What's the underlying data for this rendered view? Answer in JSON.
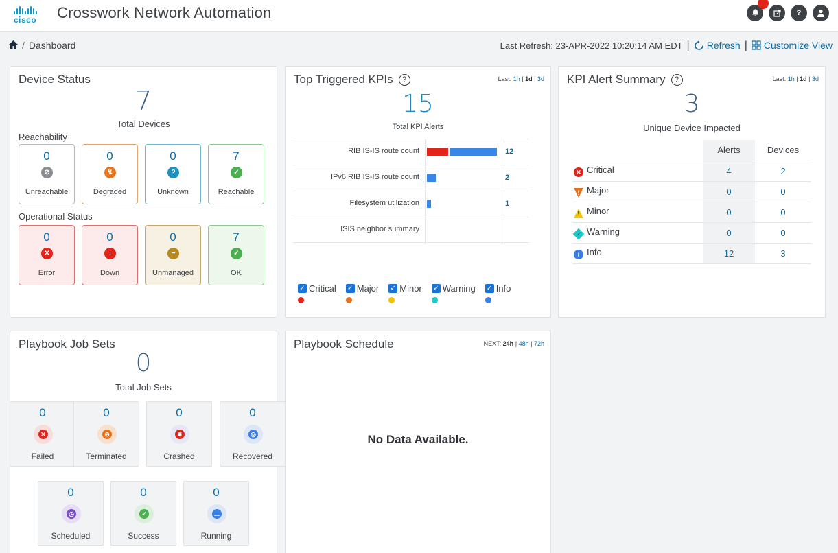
{
  "header": {
    "logo_text": "cisco",
    "title": "Crosswork Network Automation",
    "icons": [
      "bell-icon",
      "external-link-icon",
      "help-icon",
      "user-icon"
    ]
  },
  "breadcrumb": {
    "home_icon": "home-icon",
    "separator": "/",
    "current": "Dashboard"
  },
  "toolbar": {
    "last_refresh": "Last Refresh: 23-APR-2022 10:20:14 AM EDT",
    "refresh_label": "Refresh",
    "customize_label": "Customize View"
  },
  "device_status": {
    "title": "Device Status",
    "total": "7",
    "total_label": "Total Devices",
    "reachability_label": "Reachability",
    "reachability": [
      {
        "count": "0",
        "label": "Unreachable",
        "color": "#8a8d91",
        "border": "#b7babd",
        "glyph": "⊘"
      },
      {
        "count": "0",
        "label": "Degraded",
        "color": "#e8731f",
        "border": "#e8a66a",
        "glyph": "↯"
      },
      {
        "count": "0",
        "label": "Unknown",
        "color": "#1e90c0",
        "border": "#6cb9d6",
        "glyph": "?"
      },
      {
        "count": "7",
        "label": "Reachable",
        "color": "#4caf50",
        "border": "#8ec78f",
        "glyph": "✓"
      }
    ],
    "operational_label": "Operational Status",
    "operational": [
      {
        "count": "0",
        "label": "Error",
        "color": "#e2231a",
        "border": "#e36d6d",
        "bg": "#fdebeb",
        "glyph": "✕"
      },
      {
        "count": "0",
        "label": "Down",
        "color": "#e2231a",
        "border": "#e36d6d",
        "bg": "#fdebeb",
        "glyph": "↓"
      },
      {
        "count": "0",
        "label": "Unmanaged",
        "color": "#b8891c",
        "border": "#c9a96a",
        "bg": "#f7f1e4",
        "glyph": "−"
      },
      {
        "count": "7",
        "label": "OK",
        "color": "#4caf50",
        "border": "#8ec78f",
        "bg": "#eef7ec",
        "glyph": "✓"
      }
    ]
  },
  "top_kpis": {
    "title": "Top Triggered KPIs",
    "range_prefix": "Last:",
    "range_1h": "1h",
    "range_1d": "1d",
    "range_3d": "3d",
    "sep": "|",
    "total": "15",
    "total_label": "Total KPI Alerts",
    "rows": [
      {
        "name": "RIB IS-IS route count",
        "value": "12",
        "critical": 4,
        "info": 12
      },
      {
        "name": "IPv6 RIB IS-IS route count",
        "value": "2",
        "critical": 0,
        "info": 2
      },
      {
        "name": "Filesystem utilization",
        "value": "1",
        "critical": 0,
        "info": 1
      },
      {
        "name": "ISIS neighbor summary",
        "value": "",
        "critical": 0,
        "info": 0
      }
    ],
    "legend": [
      {
        "label": "Critical",
        "color": "#e2231a"
      },
      {
        "label": "Major",
        "color": "#e8731f"
      },
      {
        "label": "Minor",
        "color": "#f2c500"
      },
      {
        "label": "Warning",
        "color": "#1ec9c9"
      },
      {
        "label": "Info",
        "color": "#3a7ee8"
      }
    ]
  },
  "kpi_alert_summary": {
    "title": "KPI Alert Summary",
    "range_prefix": "Last:",
    "range_1h": "1h",
    "range_1d": "1d",
    "range_3d": "3d",
    "sep": "|",
    "total": "3",
    "total_label": "Unique Device Impacted",
    "col_alerts": "Alerts",
    "col_devices": "Devices",
    "rows": [
      {
        "severity": "Critical",
        "alerts": "4",
        "devices": "2",
        "icon": "critical-icon",
        "color": "#e2231a",
        "glyph": "✕"
      },
      {
        "severity": "Major",
        "alerts": "0",
        "devices": "0",
        "icon": "major-icon",
        "color": "#e8731f",
        "glyph": "!"
      },
      {
        "severity": "Minor",
        "alerts": "0",
        "devices": "0",
        "icon": "minor-icon",
        "color": "#f2c500",
        "glyph": "!"
      },
      {
        "severity": "Warning",
        "alerts": "0",
        "devices": "0",
        "icon": "warning-icon",
        "color": "#1ec9c9",
        "glyph": "!"
      },
      {
        "severity": "Info",
        "alerts": "12",
        "devices": "3",
        "icon": "info-icon",
        "color": "#3a7ee8",
        "glyph": "i"
      }
    ]
  },
  "playbook_job_sets": {
    "title": "Playbook Job Sets",
    "total": "0",
    "total_label": "Total Job Sets",
    "row1": [
      {
        "count": "0",
        "label": "Failed",
        "color": "#e2231a",
        "bg": "#f8dcdc",
        "glyph": "✕"
      },
      {
        "count": "0",
        "label": "Terminated",
        "color": "#e8731f",
        "bg": "#f9e0cc",
        "glyph": "⊘"
      },
      {
        "count": "0",
        "label": "Crashed",
        "color": "#e2231a",
        "bg": "#e6e7f5",
        "glyph": "✸"
      },
      {
        "count": "0",
        "label": "Recovered",
        "color": "#3a7ee8",
        "bg": "#dde6f7",
        "glyph": "◎"
      }
    ],
    "row2": [
      {
        "count": "0",
        "label": "Scheduled",
        "color": "#7b4fc9",
        "bg": "#e6dcf5",
        "glyph": "◷"
      },
      {
        "count": "0",
        "label": "Success",
        "color": "#4caf50",
        "bg": "#dcefdc",
        "glyph": "✓"
      },
      {
        "count": "0",
        "label": "Running",
        "color": "#3a7ee8",
        "bg": "#dde6f7",
        "glyph": "…"
      }
    ]
  },
  "playbook_schedule": {
    "title": "Playbook Schedule",
    "range_prefix": "NEXT:",
    "range_24h": "24h",
    "range_48h": "48h",
    "range_72h": "72h",
    "sep": "|",
    "empty_text": "No Data Available."
  }
}
